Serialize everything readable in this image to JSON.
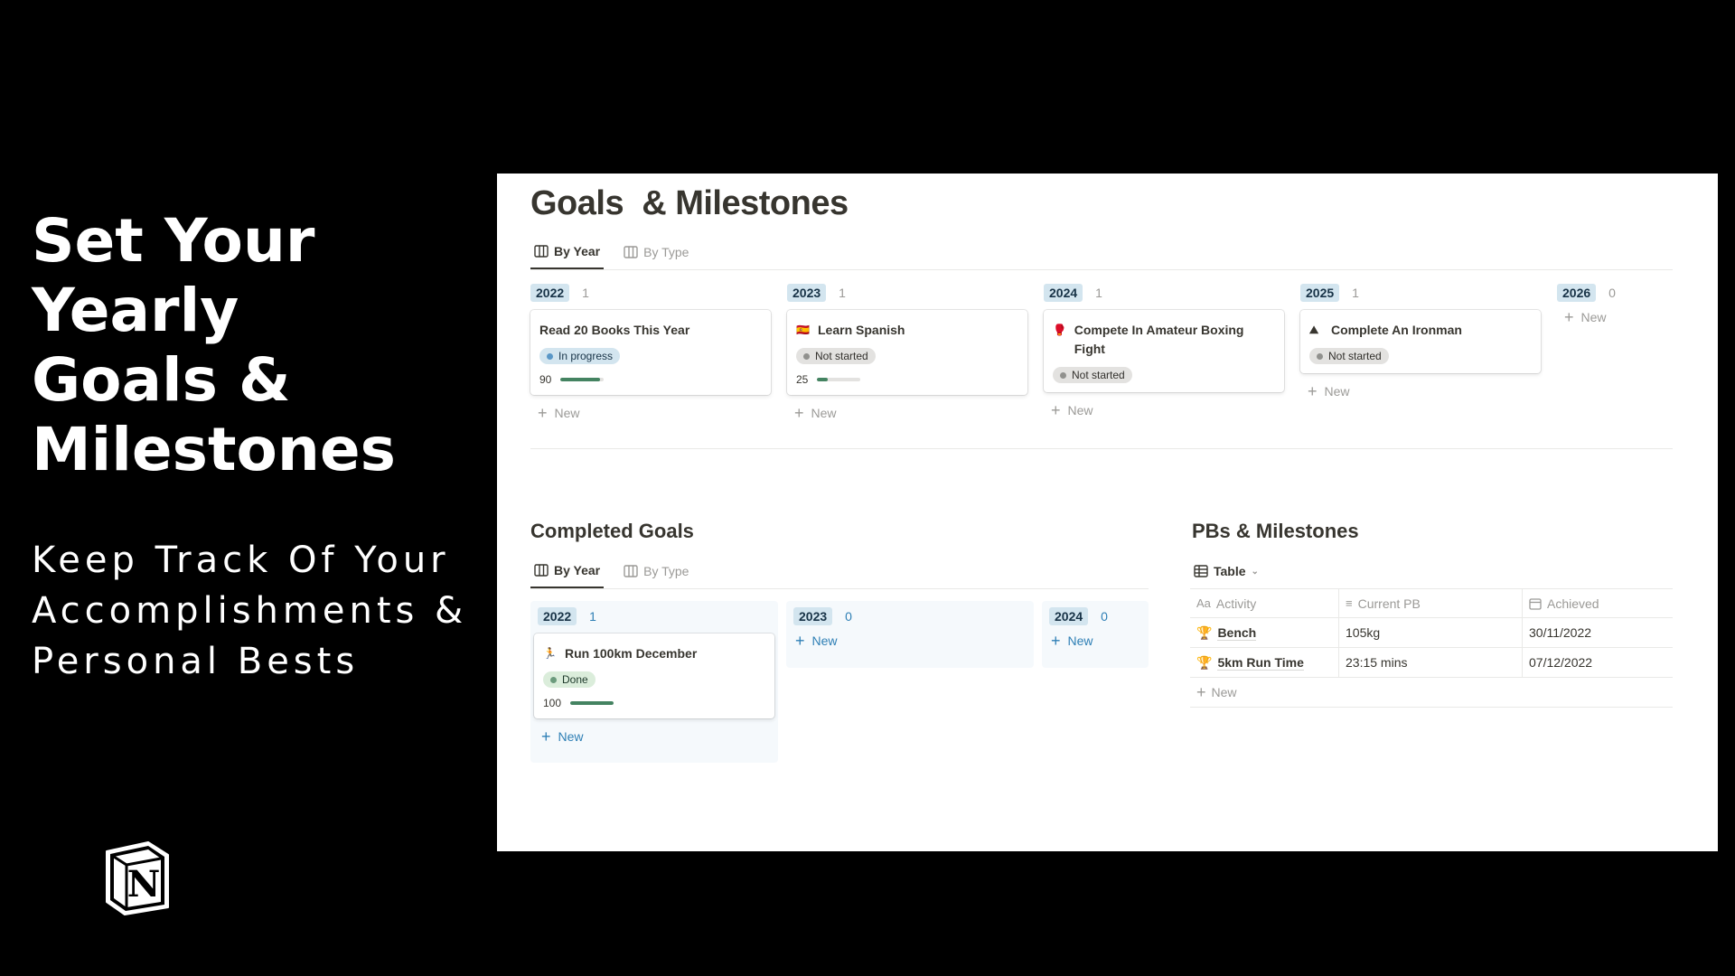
{
  "hero": {
    "title_lines": [
      "Set Your Yearly",
      "Goals &",
      "Milestones"
    ],
    "subtitle_lines": [
      "Keep Track Of Your",
      "Accomplishments &",
      "Personal Bests"
    ]
  },
  "page": {
    "title": "Goals  & Milestones"
  },
  "goals_view": {
    "tabs": [
      {
        "label": "By Year",
        "icon": "board-icon"
      },
      {
        "label": "By Type",
        "icon": "board-icon"
      }
    ],
    "columns": [
      {
        "year": "2022",
        "count": "1",
        "card": {
          "emoji": "",
          "title": "Read 20 Books This Year",
          "status": "In progress",
          "progress_text": "90",
          "progress": 0.9
        },
        "new_label": "New"
      },
      {
        "year": "2023",
        "count": "1",
        "card": {
          "emoji": "🇪🇸",
          "title": "Learn Spanish",
          "status": "Not started",
          "progress_text": "25",
          "progress": 0.25
        },
        "new_label": "New"
      },
      {
        "year": "2024",
        "count": "1",
        "card": {
          "emoji": "🥊",
          "title": "Compete In Amateur Boxing Fight",
          "status": "Not started"
        },
        "new_label": "New"
      },
      {
        "year": "2025",
        "count": "1",
        "card": {
          "emoji": "⛰",
          "title": "Complete An Ironman",
          "status": "Not started"
        },
        "new_label": "New"
      },
      {
        "year": "2026",
        "count": "0",
        "new_label": "New"
      }
    ]
  },
  "completed": {
    "title": "Completed Goals",
    "tabs": [
      {
        "label": "By Year",
        "icon": "board-icon"
      },
      {
        "label": "By Type",
        "icon": "board-icon"
      }
    ],
    "columns": [
      {
        "year": "2022",
        "count": "1",
        "card": {
          "emoji": "🏃",
          "title": "Run 100km December",
          "status": "Done",
          "progress_text": "100",
          "progress": 1.0
        },
        "new_label": "New"
      },
      {
        "year": "2023",
        "count": "0",
        "new_label": "New"
      },
      {
        "year": "2024",
        "count": "0",
        "new_label": "New"
      }
    ]
  },
  "pbs": {
    "title": "PBs & Milestones",
    "view_label": "Table",
    "headers": [
      "Activity",
      "Current PB",
      "Achieved"
    ],
    "header_icons": [
      "Aa",
      "≡",
      "calendar-icon"
    ],
    "rows": [
      {
        "activity": "Bench",
        "pb": "105kg",
        "achieved": "30/11/2022"
      },
      {
        "activity": "5km Run Time",
        "pb": "23:15 mins",
        "achieved": "07/12/2022"
      }
    ],
    "new_label": "New"
  },
  "colors": {
    "in_progress": "#d3e5ef",
    "not_started": "#e3e2e0",
    "done": "#dbeddb",
    "progress_fill": "#448361",
    "year_pill": "#d3e5ef"
  }
}
